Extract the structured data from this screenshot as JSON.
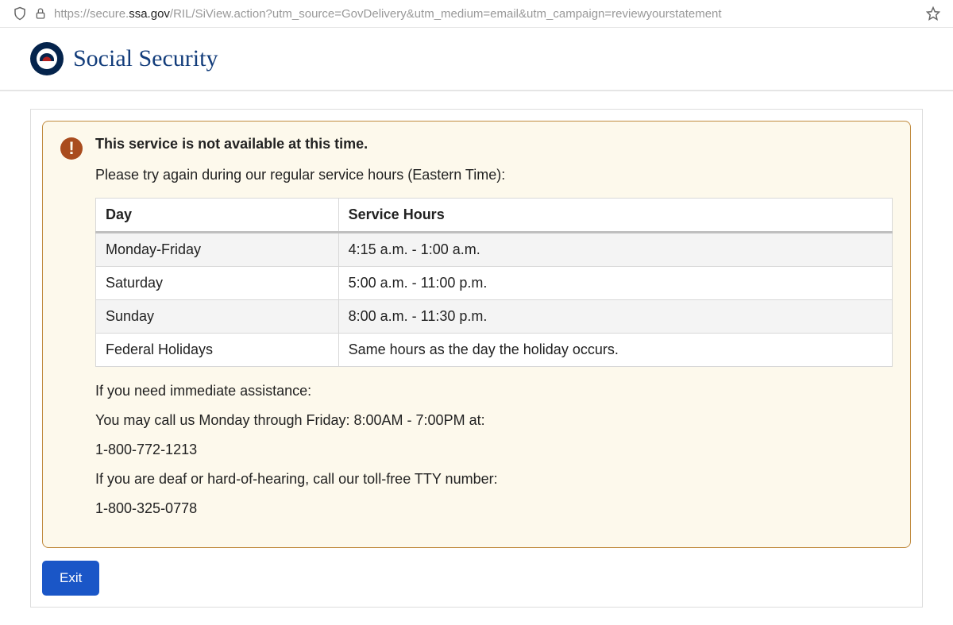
{
  "url": {
    "prefix": "https://secure.",
    "domain": "ssa.gov",
    "suffix": "/RIL/SiView.action?utm_source=GovDelivery&utm_medium=email&utm_campaign=reviewyourstatement"
  },
  "header": {
    "title": "Social Security"
  },
  "alert": {
    "title": "This service is not available at this time.",
    "intro": "Please try again during our regular service hours (Eastern Time):",
    "table": {
      "head_day": "Day",
      "head_hours": "Service Hours",
      "rows": [
        {
          "day": "Monday-Friday",
          "hours": "4:15 a.m. - 1:00 a.m."
        },
        {
          "day": "Saturday",
          "hours": "5:00 a.m. - 11:00 p.m."
        },
        {
          "day": "Sunday",
          "hours": "8:00 a.m. - 11:30 p.m."
        },
        {
          "day": "Federal Holidays",
          "hours": "Same hours as the day the holiday occurs."
        }
      ]
    },
    "assist_lines": [
      "If you need immediate assistance:",
      "You may call us Monday through Friday: 8:00AM - 7:00PM at:",
      "1-800-772-1213",
      "If you are deaf or hard-of-hearing, call our toll-free TTY number:",
      "1-800-325-0778"
    ]
  },
  "exit_label": "Exit"
}
